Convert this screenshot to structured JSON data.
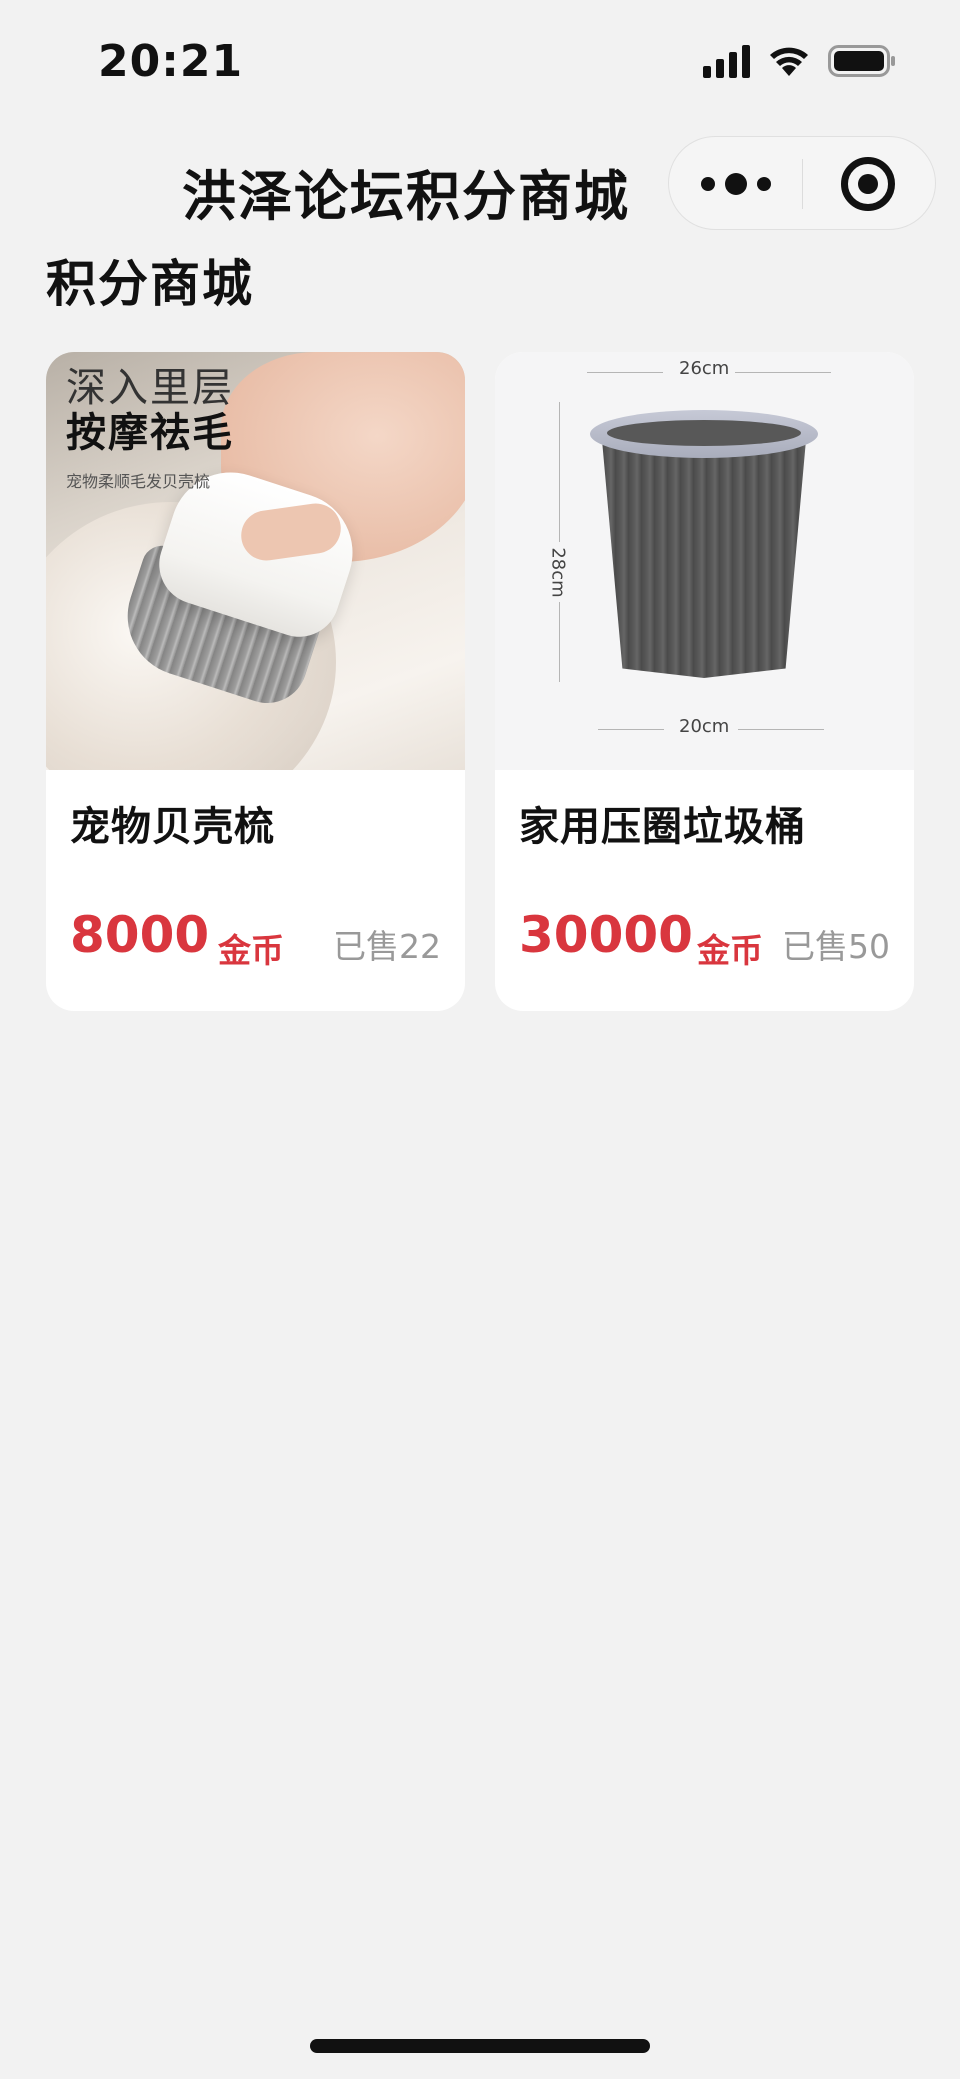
{
  "status_bar": {
    "time": "20:21"
  },
  "nav": {
    "title": "洪泽论坛积分商城"
  },
  "section": {
    "title": "积分商城"
  },
  "products": [
    {
      "name": "宠物贝壳梳",
      "price": "8000",
      "currency": "金币",
      "sold": "已售22",
      "image_text": {
        "line1": "深入里层",
        "line2": "按摩祛毛",
        "line3": "宠物柔顺毛发贝壳梳"
      }
    },
    {
      "name": "家用压圈垃圾桶",
      "price": "30000",
      "currency": "金币",
      "sold": "已售50",
      "image_text": {
        "width_top": "26cm",
        "height": "28cm",
        "width_bottom": "20cm"
      }
    }
  ],
  "colors": {
    "price": "#d9363e",
    "background": "#f2f2f2",
    "card": "#ffffff",
    "sold": "#999999"
  }
}
